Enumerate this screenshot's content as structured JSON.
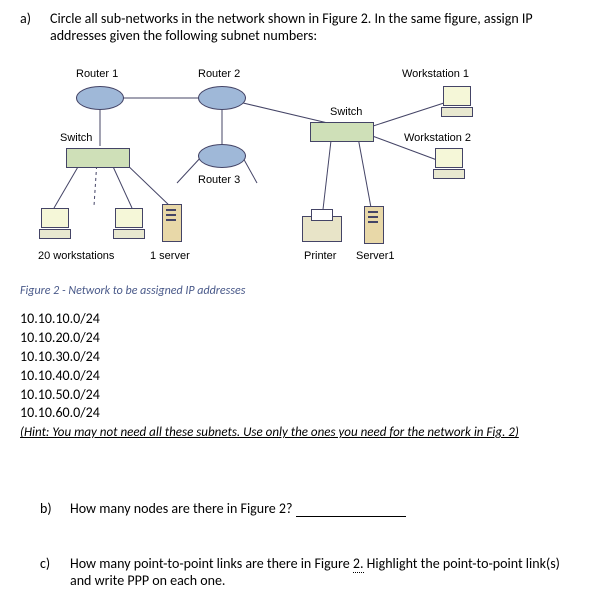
{
  "questions": {
    "a": {
      "label": "a)",
      "text": "Circle all sub-networks in the network shown in Figure 2. In the same figure, assign IP addresses given the following subnet numbers:"
    },
    "b": {
      "label": "b)",
      "text": "How many nodes are there in Figure 2?"
    },
    "c": {
      "label": "c)",
      "text_pre": "How many point-to-point links are there in Figure ",
      "text_link": "2.",
      "text_post": " Highlight the point-to-point link(s) and write PPP on each one."
    }
  },
  "diagram": {
    "router1": "Router 1",
    "router2": "Router 2",
    "router3": "Router 3",
    "switch_left": "Switch",
    "switch_right": "Switch",
    "ws1": "Workstation 1",
    "ws2": "Workstation 2",
    "twenty_ws": "20 workstations",
    "one_server": "1 server",
    "printer": "Printer",
    "server1": "Server1"
  },
  "caption": "Figure 2 - Network to be assigned IP addresses",
  "subnets": [
    "10.10.10.0/24",
    "10.10.20.0/24",
    "10.10.30.0/24",
    "10.10.40.0/24",
    "10.10.50.0/24",
    "10.10.60.0/24"
  ],
  "hint": "(Hint: You may not need all these subnets. Use only the ones you need for the network in Fig. 2)"
}
